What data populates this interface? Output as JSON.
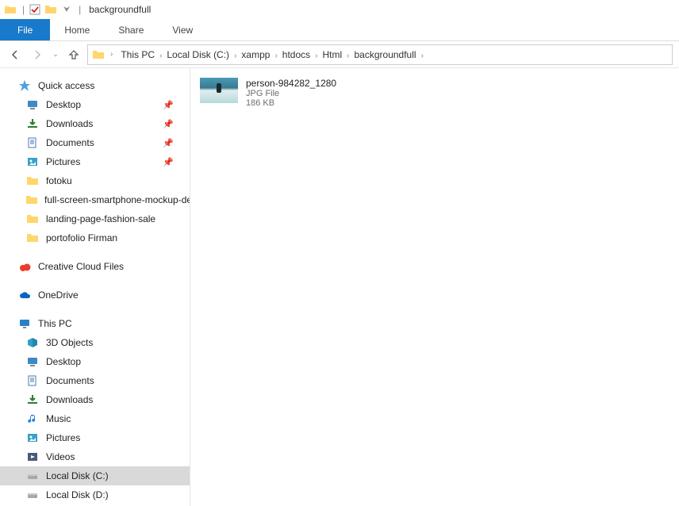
{
  "titlebar": {
    "title": "backgroundfull"
  },
  "ribbon": {
    "file": "File",
    "home": "Home",
    "share": "Share",
    "view": "View"
  },
  "breadcrumbs": [
    "This PC",
    "Local Disk (C:)",
    "xampp",
    "htdocs",
    "Html",
    "backgroundfull"
  ],
  "nav": {
    "quick_access": "Quick access",
    "quick_items": [
      {
        "label": "Desktop",
        "pinned": true,
        "icon": "desktop"
      },
      {
        "label": "Downloads",
        "pinned": true,
        "icon": "downloads"
      },
      {
        "label": "Documents",
        "pinned": true,
        "icon": "documents"
      },
      {
        "label": "Pictures",
        "pinned": true,
        "icon": "pictures"
      },
      {
        "label": "fotoku",
        "pinned": false,
        "icon": "folder"
      },
      {
        "label": "full-screen-smartphone-mockup-design",
        "pinned": false,
        "icon": "folder"
      },
      {
        "label": "landing-page-fashion-sale",
        "pinned": false,
        "icon": "folder"
      },
      {
        "label": "portofolio Firman",
        "pinned": false,
        "icon": "folder"
      }
    ],
    "creative_cloud": "Creative Cloud Files",
    "onedrive": "OneDrive",
    "this_pc": "This PC",
    "pc_items": [
      {
        "label": "3D Objects",
        "icon": "3d"
      },
      {
        "label": "Desktop",
        "icon": "desktop"
      },
      {
        "label": "Documents",
        "icon": "documents"
      },
      {
        "label": "Downloads",
        "icon": "downloads"
      },
      {
        "label": "Music",
        "icon": "music"
      },
      {
        "label": "Pictures",
        "icon": "pictures"
      },
      {
        "label": "Videos",
        "icon": "videos"
      },
      {
        "label": "Local Disk (C:)",
        "icon": "drive",
        "selected": true
      },
      {
        "label": "Local Disk (D:)",
        "icon": "drive"
      }
    ]
  },
  "files": [
    {
      "name": "person-984282_1280",
      "type": "JPG File",
      "size": "186 KB"
    }
  ]
}
